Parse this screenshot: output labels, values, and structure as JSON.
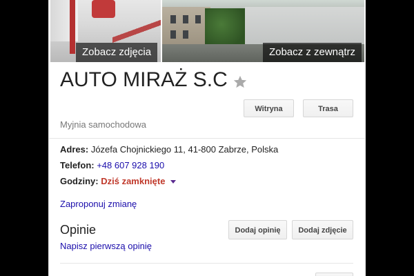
{
  "photos": {
    "left_caption": "Zobacz zdjęcia",
    "right_caption": "Zobacz z zewnątrz"
  },
  "business": {
    "name": "AUTO MIRAŻ S.C",
    "category": "Myjnia samochodowa"
  },
  "actions": {
    "website": "Witryna",
    "directions": "Trasa"
  },
  "details": {
    "address_label": "Adres:",
    "address_value": "Józefa Chojnickiego 11, 41-800 Zabrze, Polska",
    "phone_label": "Telefon:",
    "phone_value": "+48 607 928 190",
    "hours_label": "Godziny:",
    "hours_value": "Dziś zamknięte"
  },
  "suggest_edit": "Zaproponuj zmianę",
  "reviews": {
    "heading": "Opinie",
    "add_review": "Dodaj opinię",
    "add_photo": "Dodaj zdjęcie",
    "write_first": "Napisz pierwszą opinię"
  },
  "colors": {
    "link": "#1a0dab",
    "closed": "#c0392b",
    "star": "#aaaaaa"
  }
}
